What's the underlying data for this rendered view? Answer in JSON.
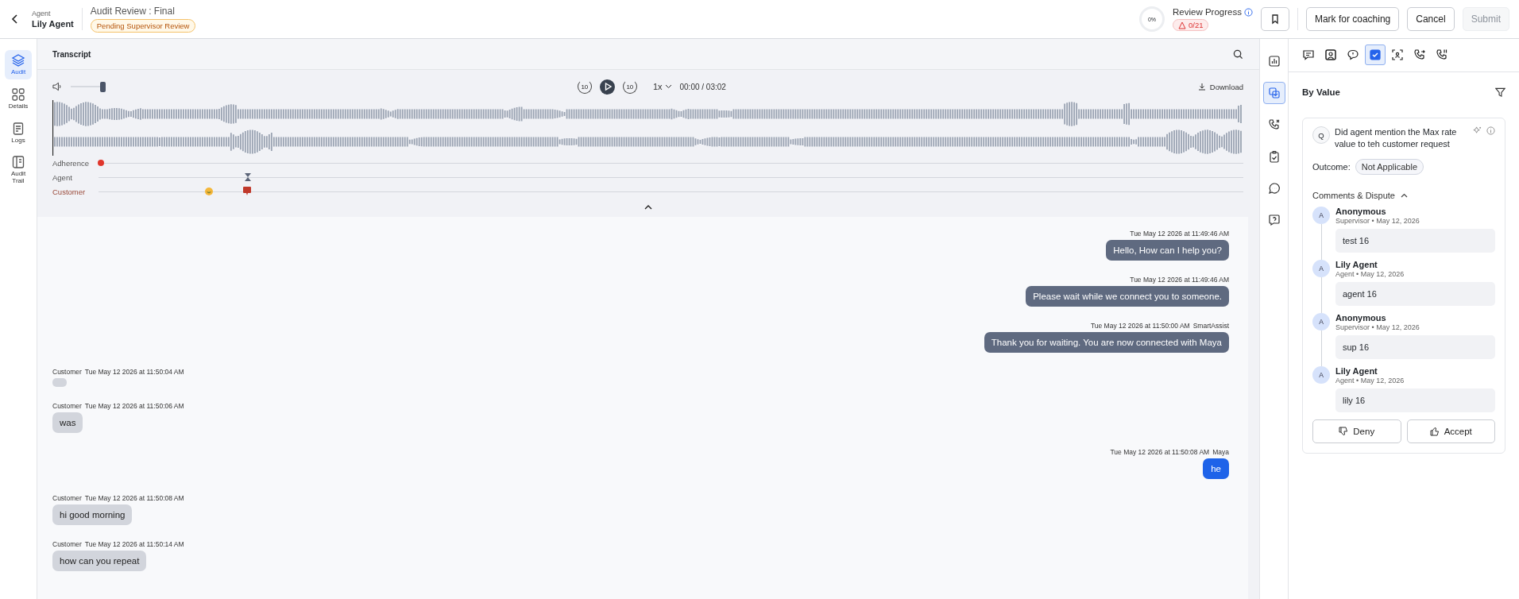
{
  "header": {
    "agent_label": "Agent",
    "agent_name": "Lily Agent",
    "title": "Audit Review : Final",
    "status_badge": "Pending Supervisor Review",
    "progress_percent": "0%",
    "progress_label": "Review Progress",
    "progress_count": "0/21",
    "buttons": [
      {
        "kind": "icon",
        "disabled": false
      },
      {
        "kind": "text",
        "label": "Mark for coaching",
        "disabled": false
      },
      {
        "kind": "text",
        "label": "Cancel",
        "disabled": false
      },
      {
        "kind": "text",
        "label": "Submit",
        "disabled": true
      }
    ]
  },
  "nav": [
    {
      "label": "Audit",
      "selected": true
    },
    {
      "label": "Details",
      "selected": false
    },
    {
      "label": "Logs",
      "selected": false
    },
    {
      "label": "Audit Trail",
      "selected": false
    }
  ],
  "transcript": {
    "title": "Transcript",
    "player": {
      "volume": {
        "level": 1
      },
      "rewind": "10",
      "forward": "10",
      "speed": "1x",
      "time": "00:00 / 03:02",
      "download": "Download"
    },
    "tracks": [
      {
        "label": "Adherence",
        "kind": "adherence",
        "color": "#e0362c"
      },
      {
        "label": "Agent",
        "kind": "agent",
        "color": "#5b6478"
      },
      {
        "label": "Customer",
        "kind": "customer",
        "color": "#c0392b"
      }
    ],
    "messages": [
      {
        "kind": "agent",
        "time": "Tue May 12 2026 at 11:49:46 AM",
        "text": "Hello, How can I help you?"
      },
      {
        "kind": "agent",
        "time": "Tue May 12 2026 at 11:49:46 AM",
        "text": "Please wait while we connect you to someone."
      },
      {
        "kind": "agent",
        "time": "Tue May 12 2026 at 11:50:00 AM",
        "speaker": "SmartAssist",
        "text": "Thank you for waiting. You are now connected with Maya"
      },
      {
        "kind": "customer",
        "speaker": "Customer",
        "time": "Tue May 12 2026 at 11:50:04 AM"
      },
      {
        "kind": "customer",
        "speaker": "Customer",
        "time": "Tue May 12 2026 at 11:50:06 AM",
        "text": "was"
      },
      {
        "kind": "live",
        "time": "Tue May 12 2026 at 11:50:08 AM",
        "speaker": "Maya",
        "text": "he"
      },
      {
        "kind": "customer",
        "speaker": "Customer",
        "time": "Tue May 12 2026 at 11:50:08 AM",
        "text": "hi good morning"
      },
      {
        "kind": "customer",
        "speaker": "Customer",
        "time": "Tue May 12 2026 at 11:50:14 AM",
        "text": "how can you repeat"
      }
    ]
  },
  "side_strip": [
    {
      "selected": false
    },
    {
      "selected": true
    },
    {
      "selected": false
    },
    {
      "selected": false
    },
    {
      "selected": false
    },
    {
      "selected": false
    }
  ],
  "panel_tabs": [
    {
      "selected": false
    },
    {
      "selected": false
    },
    {
      "selected": false
    },
    {
      "selected": true
    },
    {
      "selected": false
    },
    {
      "selected": false
    },
    {
      "selected": false
    }
  ],
  "panel": {
    "title": "By Value",
    "question_badge": "Q",
    "question": "Did agent mention the Max rate value to teh customer request",
    "outcome_label": "Outcome:",
    "outcome": "Not Applicable",
    "comments_title": "Comments & Dispute",
    "comments_expanded": true,
    "comments": [
      {
        "avatar": "A",
        "name": "Anonymous",
        "meta": "Supervisor • May 12, 2026",
        "body": "test 16"
      },
      {
        "avatar": "A",
        "name": "Lily Agent",
        "meta": "Agent • May 12, 2026",
        "body": "agent 16"
      },
      {
        "avatar": "A",
        "name": "Anonymous",
        "meta": "Supervisor • May 12, 2026",
        "body": "sup 16"
      },
      {
        "avatar": "A",
        "name": "Lily Agent",
        "meta": "Agent • May 12, 2026",
        "body": "lily 16"
      }
    ],
    "deny": "Deny",
    "accept": "Accept"
  }
}
